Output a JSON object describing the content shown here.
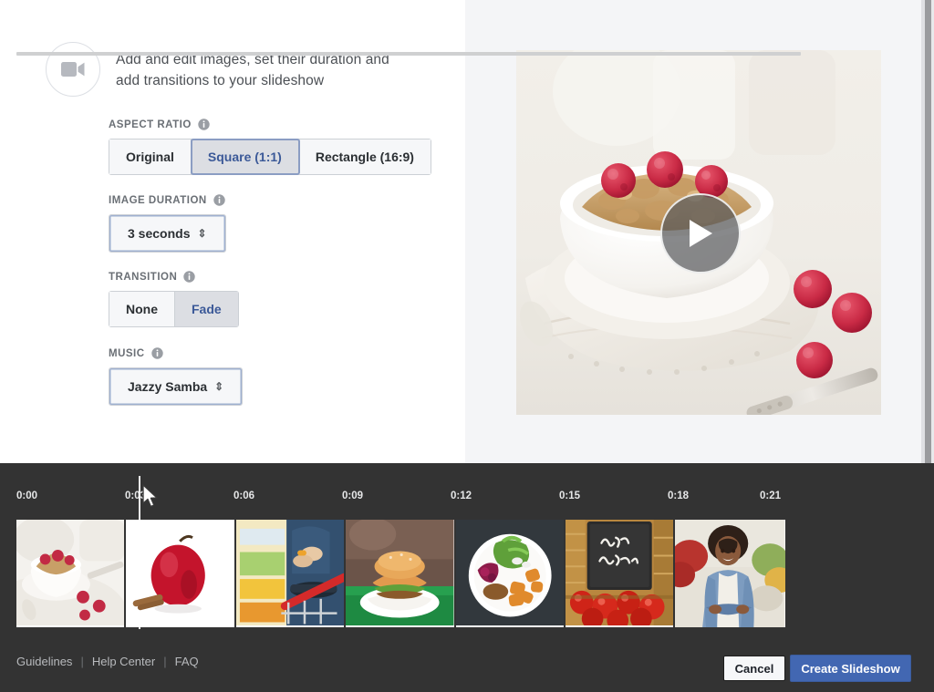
{
  "header": {
    "icon": "video-camera-icon",
    "description_line1": "Add and edit images, set their duration and",
    "description_line2": "add transitions to your slideshow"
  },
  "form": {
    "aspect_ratio": {
      "label": "ASPECT RATIO",
      "info_icon": "info-icon",
      "options": [
        "Original",
        "Square (1:1)",
        "Rectangle (16:9)"
      ],
      "selected": "Square (1:1)"
    },
    "image_duration": {
      "label": "IMAGE DURATION",
      "info_icon": "info-icon",
      "value": "3 seconds",
      "caret": "⇕"
    },
    "transition": {
      "label": "TRANSITION",
      "info_icon": "info-icon",
      "options": [
        "None",
        "Fade"
      ],
      "selected": "Fade"
    },
    "music": {
      "label": "MUSIC",
      "info_icon": "info-icon",
      "value": "Jazzy Samba",
      "caret": "⇕"
    }
  },
  "preview": {
    "play_icon": "play-icon",
    "description": "Bowl of granola with raspberries on white linen"
  },
  "timeline": {
    "ticks": [
      "0:00",
      "0:03",
      "0:06",
      "0:09",
      "0:12",
      "0:15",
      "0:18",
      "0:21"
    ],
    "thumbnails": [
      "granola-bowl-raspberries",
      "red-apple-cinnamon",
      "shopping-cart-produce",
      "veggie-burger-plate",
      "salad-sweet-potato-plate",
      "buy-local-tomatoes",
      "farmers-market-vendor"
    ]
  },
  "footer": {
    "links": [
      "Guidelines",
      "Help Center",
      "FAQ"
    ],
    "separator": "|",
    "cancel_label": "Cancel",
    "create_label": "Create Slideshow"
  },
  "colors": {
    "accent_blue": "#3b5998",
    "primary_button": "#4267b2",
    "timeline_bg": "#333333",
    "panel_bg": "#f4f5f7"
  }
}
